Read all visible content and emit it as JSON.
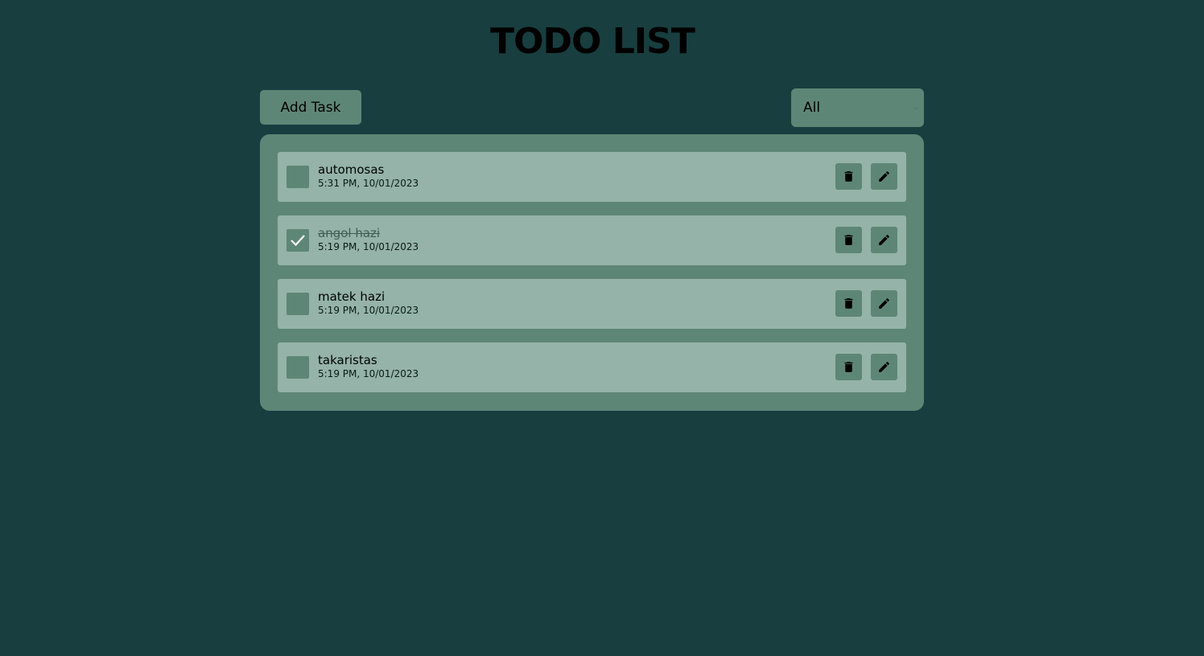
{
  "app": {
    "title": "TODO LIST"
  },
  "toolbar": {
    "add_label": "Add Task",
    "filter_value": "All"
  },
  "colors": {
    "background": "#183e3f",
    "panel": "#5e8676",
    "item": "#95b3a8"
  },
  "tasks": [
    {
      "title": "automosas",
      "time": "5:31 PM, 10/01/2023",
      "completed": false
    },
    {
      "title": "angol hazi",
      "time": "5:19 PM, 10/01/2023",
      "completed": true
    },
    {
      "title": "matek hazi",
      "time": "5:19 PM, 10/01/2023",
      "completed": false
    },
    {
      "title": "takaristas",
      "time": "5:19 PM, 10/01/2023",
      "completed": false
    }
  ],
  "icons": {
    "delete": "trash-icon",
    "edit": "pencil-icon",
    "check": "checkmark-icon",
    "dropdown": "chevron-down-icon"
  }
}
